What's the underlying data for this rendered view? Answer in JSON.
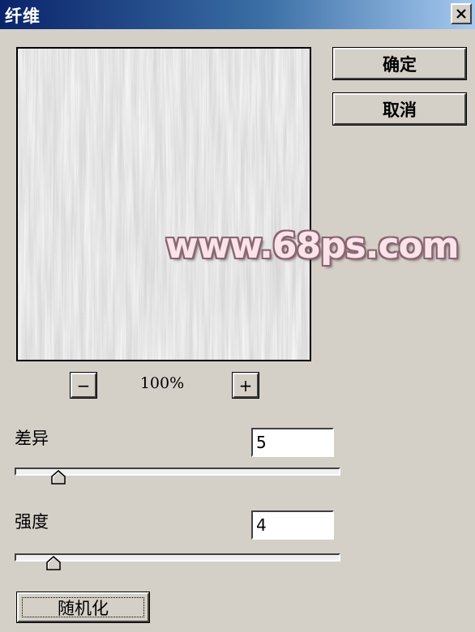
{
  "window": {
    "title": "纤维"
  },
  "buttons": {
    "ok_label": "确定",
    "cancel_label": "取消",
    "randomize_label": "随机化"
  },
  "preview": {
    "zoom_out_label": "−",
    "zoom_in_label": "+",
    "zoom_level": "100%",
    "watermark": "www.68ps.com"
  },
  "params": {
    "variance": {
      "label": "差异",
      "value": "5",
      "min": 1,
      "max": 64,
      "level": 5
    },
    "strength": {
      "label": "强度",
      "value": "4",
      "min": 1,
      "max": 64,
      "level": 4
    }
  },
  "colors": {
    "titlebar_start": "#0a246a",
    "titlebar_end": "#a6caf0",
    "dialog_bg": "#d4d0c8"
  },
  "icons": {
    "close": "close-icon",
    "slider_thumb": "slider-thumb-icon"
  }
}
